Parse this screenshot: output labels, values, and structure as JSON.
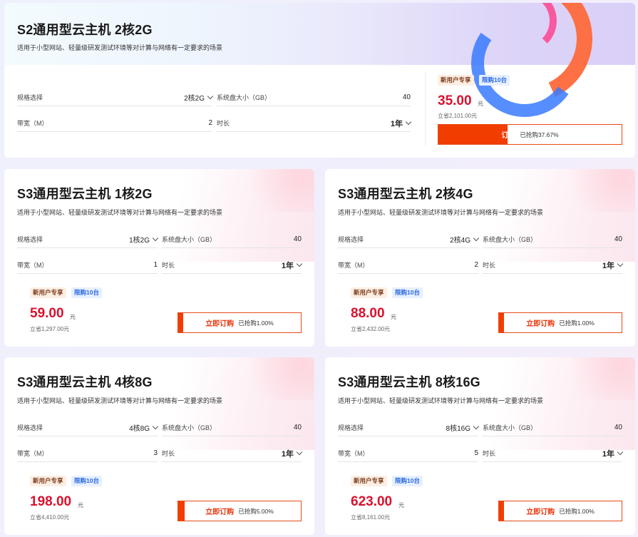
{
  "common": {
    "desc": "适用于小型网站、轻量级研发测试环境等对计算与网络有一定要求的场景",
    "spec_label": "规格选择",
    "disk_label": "系统盘大小（GB）",
    "bw_label": "带宽（M）",
    "dur_label": "时长",
    "badge_new": "新用户专享",
    "badge_limit": "限购10台",
    "yuan": "元",
    "buy_label": "立即订购",
    "buy_label_short": "订购"
  },
  "cards": [
    {
      "title": "S2通用型云主机 2核2G",
      "spec": "2核2G",
      "disk": "40",
      "bw": "2",
      "dur": "1年",
      "price": "35.00",
      "save": "立省2,101.00元",
      "sold": "已抢购37.67%",
      "progress": 0.3767
    },
    {
      "title": "S3通用型云主机 1核2G",
      "spec": "1核2G",
      "disk": "40",
      "bw": "1",
      "dur": "1年",
      "price": "59.00",
      "save": "立省1,297.00元",
      "sold": "已抢购1.00%",
      "progress": 0.01
    },
    {
      "title": "S3通用型云主机 2核4G",
      "spec": "2核4G",
      "disk": "40",
      "bw": "2",
      "dur": "1年",
      "price": "88.00",
      "save": "立省2,432.00元",
      "sold": "已抢购1.00%",
      "progress": 0.01
    },
    {
      "title": "S3通用型云主机 4核8G",
      "spec": "4核8G",
      "disk": "40",
      "bw": "3",
      "dur": "1年",
      "price": "198.00",
      "save": "立省4,410.00元",
      "sold": "已抢购5.00%",
      "progress": 0.05
    },
    {
      "title": "S3通用型云主机 8核16G",
      "spec": "8核16G",
      "disk": "40",
      "bw": "5",
      "dur": "1年",
      "price": "623.00",
      "save": "立省8,161.00元",
      "sold": "已抢购1.00%",
      "progress": 0.01
    }
  ]
}
